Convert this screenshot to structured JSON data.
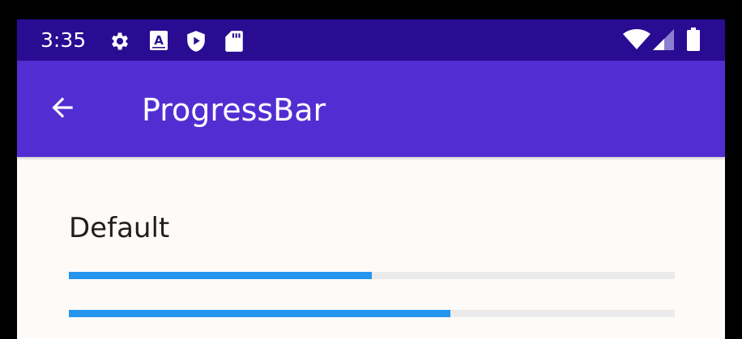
{
  "status_bar": {
    "time": "3:35",
    "icons": [
      "gear-icon",
      "a-notification-icon",
      "shield-play-icon",
      "sd-card-icon",
      "wifi-icon",
      "signal-icon",
      "battery-icon"
    ]
  },
  "app_bar": {
    "title": "ProgressBar",
    "back_icon": "arrow-back-icon"
  },
  "content": {
    "section_label": "Default",
    "progress_bars": [
      {
        "progress": 0.5
      },
      {
        "progress": 0.63
      }
    ]
  },
  "colors": {
    "status_bar": "#2A0C93",
    "app_bar": "#522ED2",
    "background": "#FEFAF8",
    "progress_fill": "#2395EE",
    "progress_track": "#EBEBEB",
    "text": "#1E1E1E"
  }
}
